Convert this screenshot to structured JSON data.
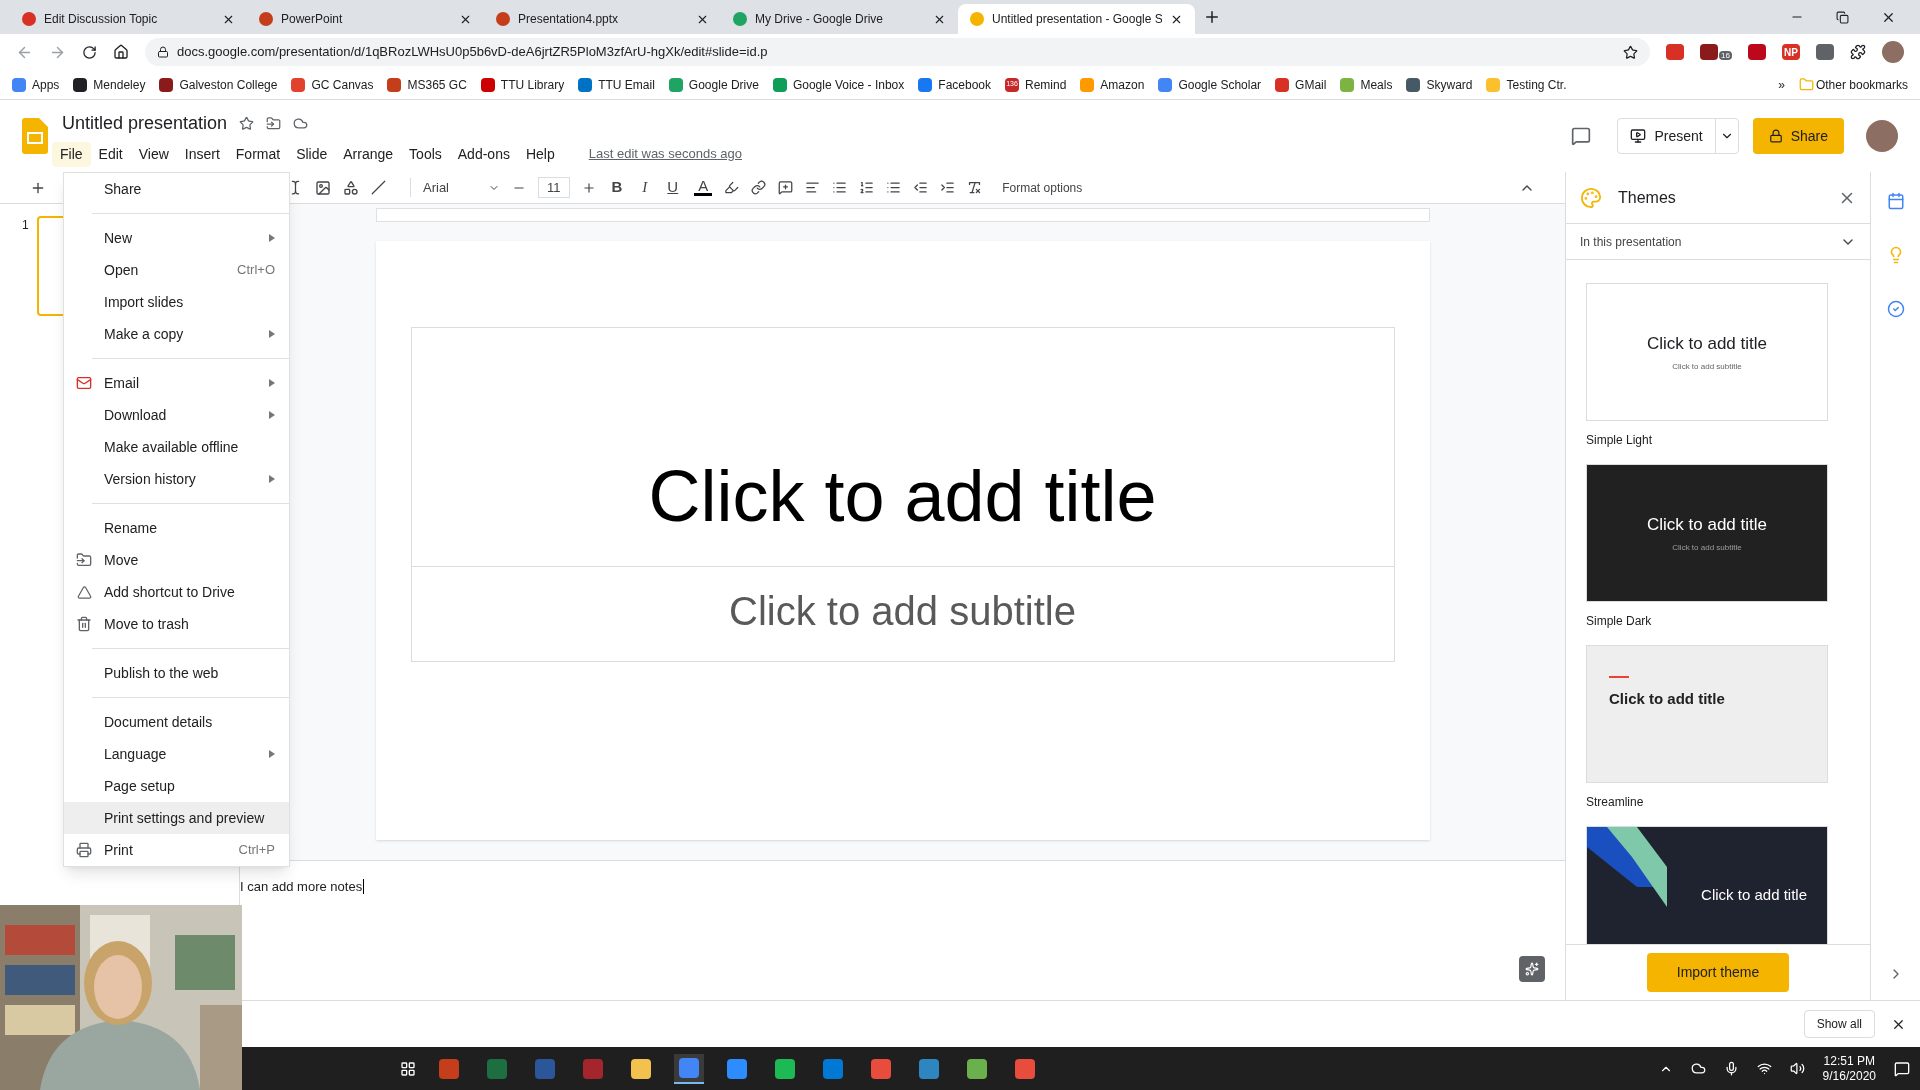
{
  "browser": {
    "tabs": [
      {
        "title": "Edit Discussion Topic",
        "selected": false,
        "color": "#d93025"
      },
      {
        "title": "PowerPoint",
        "selected": false,
        "color": "#c43e1c"
      },
      {
        "title": "Presentation4.pptx",
        "selected": false,
        "color": "#c43e1c"
      },
      {
        "title": "My Drive - Google Drive",
        "selected": false,
        "color": "#1fa463"
      },
      {
        "title": "Untitled presentation - Google S",
        "selected": true,
        "color": "#f4b400"
      }
    ],
    "url": "docs.google.com/presentation/d/1qBRozLWHsU0p5b6vD-deA6jrtZR5PloM3zfArU-hgXk/edit#slide=id.p",
    "extensions": [
      {
        "color": "#d93025"
      },
      {
        "color": "#8b1a1a",
        "badge": "16"
      },
      {
        "color": "#bd081c"
      },
      {
        "color": "#d93025",
        "label": "NP"
      },
      {
        "color": "#5f6368"
      }
    ],
    "bookmarks": [
      {
        "label": "Apps",
        "color": "#4285f4"
      },
      {
        "label": "Mendeley",
        "color": "#202124"
      },
      {
        "label": "Galveston College",
        "color": "#8b1a1a"
      },
      {
        "label": "GC Canvas",
        "color": "#e2412e"
      },
      {
        "label": "MS365 GC",
        "color": "#c43e1c"
      },
      {
        "label": "TTU Library",
        "color": "#cc0000"
      },
      {
        "label": "TTU Email",
        "color": "#0072c6"
      },
      {
        "label": "Google Drive",
        "color": "#1fa463"
      },
      {
        "label": "Google Voice - Inbox",
        "color": "#0f9d58"
      },
      {
        "label": "Facebook",
        "color": "#1877f2"
      },
      {
        "label": "Remind",
        "color": "#c62828",
        "badge": "136"
      },
      {
        "label": "Amazon",
        "color": "#ff9900"
      },
      {
        "label": "Google Scholar",
        "color": "#4285f4"
      },
      {
        "label": "GMail",
        "color": "#d93025"
      },
      {
        "label": "Meals",
        "color": "#7cb342"
      },
      {
        "label": "Skyward",
        "color": "#455a64"
      },
      {
        "label": "Testing Ctr.",
        "color": "#fbc02d"
      }
    ],
    "more_bookmarks": "»",
    "other_bookmarks": "Other bookmarks"
  },
  "doc": {
    "title": "Untitled presentation",
    "menus": [
      {
        "label": "File",
        "selected": true
      },
      {
        "label": "Edit",
        "selected": false
      },
      {
        "label": "View",
        "selected": false
      },
      {
        "label": "Insert",
        "selected": false
      },
      {
        "label": "Format",
        "selected": false
      },
      {
        "label": "Slide",
        "selected": false
      },
      {
        "label": "Arrange",
        "selected": false
      },
      {
        "label": "Tools",
        "selected": false
      },
      {
        "label": "Add-ons",
        "selected": false
      },
      {
        "label": "Help",
        "selected": false
      }
    ],
    "last_edit": "Last edit was seconds ago",
    "present": "Present",
    "share": "Share"
  },
  "toolbar": {
    "font": "Arial",
    "size": "11",
    "format_buttons": [
      {
        "label": "B",
        "kind": "bold"
      },
      {
        "label": "I",
        "kind": "italic"
      },
      {
        "label": "U",
        "kind": "underline"
      },
      {
        "label": "A",
        "kind": "color"
      }
    ],
    "format_options": "Format options"
  },
  "file_menu": [
    {
      "kind": "item",
      "label": "Share",
      "submenu": false,
      "selected": false
    },
    {
      "kind": "separator"
    },
    {
      "kind": "item",
      "label": "New",
      "submenu": true,
      "selected": false
    },
    {
      "kind": "item",
      "label": "Open",
      "shortcut": "Ctrl+O",
      "submenu": false,
      "selected": false
    },
    {
      "kind": "item",
      "label": "Import slides",
      "submenu": false,
      "selected": false
    },
    {
      "kind": "item",
      "label": "Make a copy",
      "submenu": true,
      "selected": false
    },
    {
      "kind": "separator"
    },
    {
      "kind": "item",
      "label": "Email",
      "submenu": true,
      "selected": false
    },
    {
      "kind": "item",
      "label": "Download",
      "submenu": true,
      "selected": false
    },
    {
      "kind": "item",
      "label": "Make available offline",
      "submenu": false,
      "selected": false
    },
    {
      "kind": "item",
      "label": "Version history",
      "submenu": true,
      "selected": false
    },
    {
      "kind": "separator"
    },
    {
      "kind": "item",
      "label": "Rename",
      "submenu": false,
      "selected": false
    },
    {
      "kind": "item",
      "label": "Move",
      "submenu": false,
      "selected": false
    },
    {
      "kind": "item",
      "label": "Add shortcut to Drive",
      "submenu": false,
      "selected": false
    },
    {
      "kind": "item",
      "label": "Move to trash",
      "submenu": false,
      "selected": false
    },
    {
      "kind": "separator"
    },
    {
      "kind": "item",
      "label": "Publish to the web",
      "submenu": false,
      "selected": false
    },
    {
      "kind": "separator"
    },
    {
      "kind": "item",
      "label": "Document details",
      "submenu": false,
      "selected": false
    },
    {
      "kind": "item",
      "label": "Language",
      "submenu": true,
      "selected": false
    },
    {
      "kind": "item",
      "label": "Page setup",
      "submenu": false,
      "selected": false
    },
    {
      "kind": "item",
      "label": "Print settings and preview",
      "submenu": false,
      "selected": true
    },
    {
      "kind": "item",
      "label": "Print",
      "shortcut": "Ctrl+P",
      "submenu": false,
      "selected": false
    }
  ],
  "filmstrip": {
    "number": "1"
  },
  "slide": {
    "title": "Click to add title",
    "subtitle": "Click to add subtitle"
  },
  "notes": "I can add more notes",
  "themes": {
    "title": "Themes",
    "scope": "In this presentation",
    "items": [
      {
        "kind": "light",
        "name": "Simple Light",
        "title": "Click to add title",
        "subtitle": "Click to add subtitle"
      },
      {
        "kind": "dark",
        "name": "Simple Dark",
        "title": "Click to add title",
        "subtitle": "Click to add subtitle"
      },
      {
        "kind": "streamline",
        "name": "Streamline",
        "title": "Click to add title"
      },
      {
        "kind": "focus",
        "title": "Click to add title"
      }
    ],
    "import": "Import theme"
  },
  "downloads": {
    "show_all": "Show all"
  },
  "taskbar": {
    "time": "12:51 PM",
    "date": "9/16/2020",
    "apps": [
      {
        "color": "#c43e1c",
        "selected": false
      },
      {
        "color": "#1d6f42",
        "selected": false
      },
      {
        "color": "#2b579a",
        "selected": false
      },
      {
        "color": "#a4262c",
        "selected": false
      },
      {
        "color": "#f2c14e",
        "selected": false
      },
      {
        "color": "#4285f4",
        "selected": true
      },
      {
        "color": "#2d8cff",
        "selected": false
      },
      {
        "color": "#1db954",
        "selected": false
      },
      {
        "color": "#0078d4",
        "selected": false
      },
      {
        "color": "#e74c3c",
        "selected": false
      },
      {
        "color": "#2e86c1",
        "selected": false
      },
      {
        "color": "#6ab04c",
        "selected": false
      },
      {
        "color": "#e74c3c",
        "selected": false
      }
    ]
  }
}
